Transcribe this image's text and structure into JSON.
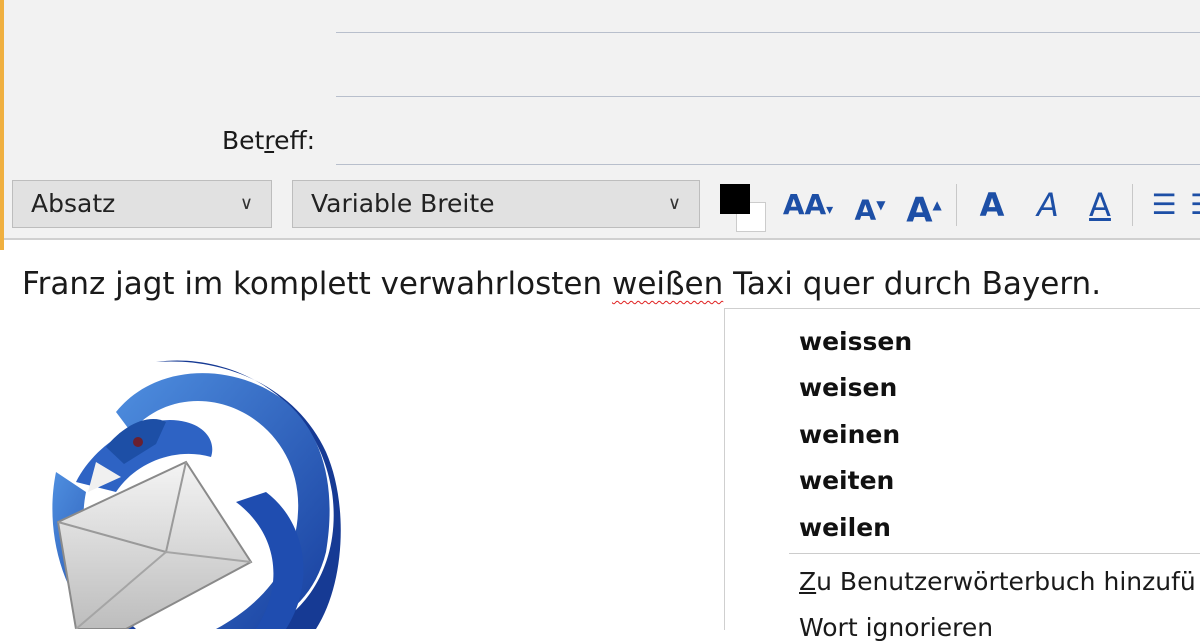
{
  "compose": {
    "subject_label_pre": "Bet",
    "subject_label_u": "r",
    "subject_label_post": "eff:"
  },
  "toolbar": {
    "paragraph_select": "Absatz",
    "font_select": "Variable Breite",
    "text_color": "#000000"
  },
  "body": {
    "text_before": "Franz jagt im komplett verwahrlosten ",
    "misspelled_word": "weißen",
    "text_after": " Taxi quer durch Bayern."
  },
  "context_menu": {
    "suggestions": [
      "weissen",
      "weisen",
      "weinen",
      "weiten",
      "weilen"
    ],
    "add_to_dictionary_u": "Z",
    "add_to_dictionary_rest": "u Benutzerwörterbuch hinzufü",
    "ignore_word": "Wort ignorieren"
  },
  "colors": {
    "accent": "#1d4fa6",
    "spellcheck_underline": "#e02020"
  }
}
